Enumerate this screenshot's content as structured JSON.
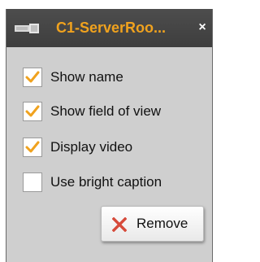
{
  "window": {
    "title": "C1-ServerRoo...",
    "close_glyph": "×",
    "icon": "camera-icon"
  },
  "options": [
    {
      "label": "Show name",
      "checked": true
    },
    {
      "label": "Show field of view",
      "checked": true
    },
    {
      "label": "Display video",
      "checked": true
    },
    {
      "label": "Use bright caption",
      "checked": false
    }
  ],
  "remove_button": {
    "label": "Remove",
    "icon": "x-icon"
  },
  "colors": {
    "accent": "#f0a21e",
    "titlebar": "#444444",
    "panel": "#cfcfcf",
    "remove_icon": "#d64a3a"
  }
}
